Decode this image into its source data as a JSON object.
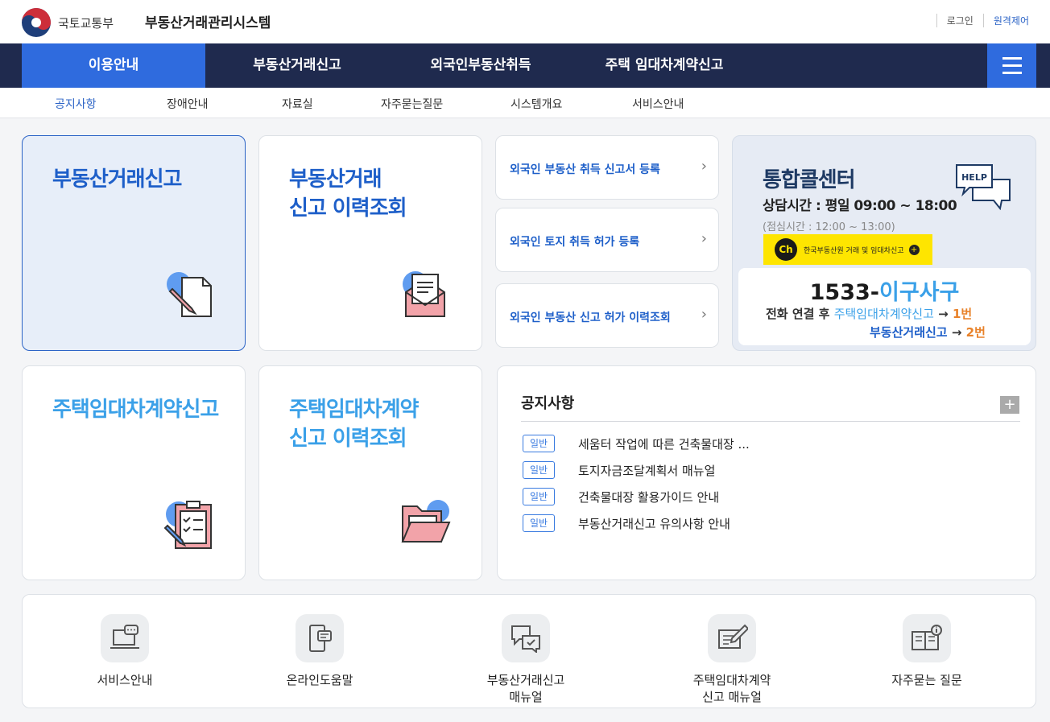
{
  "header": {
    "ministry_name": "국토교통부",
    "site_title": "부동산거래관리시스템",
    "utility_links": [
      "로그인",
      "원격제어"
    ]
  },
  "gnb": {
    "items": [
      "이용안내",
      "부동산거래신고",
      "외국인부동산취득",
      "주택 임대차계약신고"
    ],
    "active_index": 0,
    "menu_icon": "hamburger-icon"
  },
  "lnb": {
    "items": [
      "공지사항",
      "장애안내",
      "자료실",
      "자주묻는질문",
      "시스템개요",
      "서비스안내"
    ],
    "active_index": 0
  },
  "cards": [
    {
      "title": "부동산거래신고",
      "icon": "document-pen-icon"
    },
    {
      "title": "부동산거래\n신고 이력조회",
      "icon": "mail-letter-icon"
    },
    {
      "title": "주택임대차계약신고",
      "icon": "clipboard-checklist-icon"
    },
    {
      "title": "주택임대차계약\n신고 이력조회",
      "icon": "open-folder-icon"
    }
  ],
  "foreigner_links": [
    "외국인 부동산 취득 신고서 등록",
    "외국인 토지 취득 허가 등록",
    "외국인 부동산 신고 허가 이력조회"
  ],
  "callcenter": {
    "title": "통합콜센터",
    "hours": "상담시간 : 평일 09:00 ~ 18:00",
    "lunch": "(점심시간 : 12:00 ~ 13:00)",
    "help_icon_text": "HELP",
    "kakao_ch": "Ch",
    "kakao_text": "한국부동산원 거래 및 임대차신고",
    "kakao_plus": "+",
    "number_prefix": "1533-",
    "number_suffix": "이구사구",
    "line1_prefix": "전화 연결 후",
    "line1_target": "주택임대차계약신고",
    "line1_arrow": "→",
    "line1_num": "1번",
    "line2_target": "부동산거래신고",
    "line2_arrow": "→",
    "line2_num": "2번"
  },
  "notice": {
    "title": "공지사항",
    "more": "+",
    "items": [
      {
        "badge": "일반",
        "text": "세움터 작업에 따른 건축물대장 ..."
      },
      {
        "badge": "일반",
        "text": "토지자금조달계획서 매뉴얼"
      },
      {
        "badge": "일반",
        "text": "건축물대장 활용가이드 안내"
      },
      {
        "badge": "일반",
        "text": "부동산거래신고 유의사항 안내"
      }
    ]
  },
  "quick": [
    {
      "label": "서비스안내",
      "icon": "laptop-chat-icon"
    },
    {
      "label": "온라인도움말",
      "icon": "mobile-help-icon"
    },
    {
      "label": "부동산거래신고\n매뉴얼",
      "icon": "qa-bubbles-icon"
    },
    {
      "label": "주택임대차계약\n신고 매뉴얼",
      "icon": "edit-note-icon"
    },
    {
      "label": "자주묻는 질문",
      "icon": "book-info-icon"
    }
  ],
  "colors": {
    "nav_bg": "#1f2a4e",
    "accent": "#2f6bde",
    "title_dark_blue": "#1e5fc9",
    "title_light_blue": "#3aa0e8",
    "highlight_orange": "#e8822a",
    "kakao_yellow": "#fee500"
  }
}
